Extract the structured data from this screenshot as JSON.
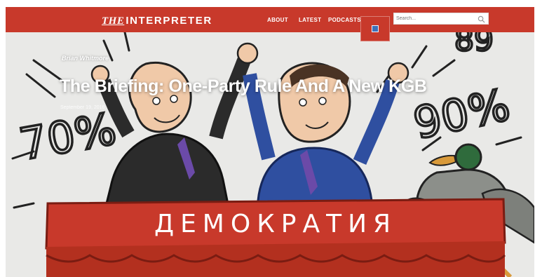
{
  "header": {
    "logo_prefix": "THE",
    "logo_name": "INTERPRETER",
    "nav": [
      "ABOUT",
      "LATEST",
      "PODCASTS"
    ],
    "search_placeholder": "Search..."
  },
  "article": {
    "author": "Brian Whitmore",
    "title": "The Briefing: One-Party Rule And A New KGB",
    "date": "September 19, 2016"
  },
  "illustration": {
    "caption": "ДЕМОКРАТИЯ",
    "percent_left": "70%",
    "percent_right": "90%",
    "percent_top_right": "89"
  },
  "colors": {
    "brand_red": "#c8392b",
    "podium_red": "#c8392b",
    "suit_dark": "#2b2b2b",
    "suit_blue": "#2f4fa0"
  },
  "icons": [
    "search-icon",
    "social-icon"
  ]
}
